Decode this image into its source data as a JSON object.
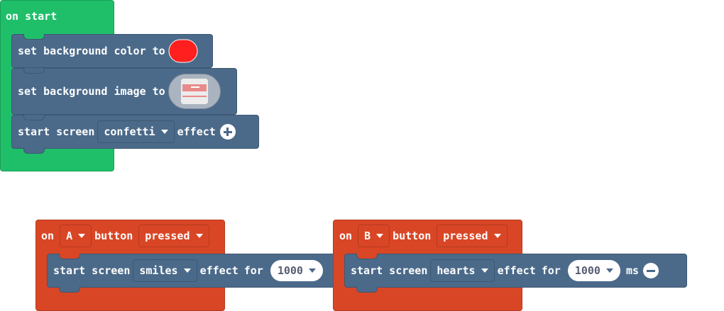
{
  "workspace": {
    "on_start": {
      "label": "on start",
      "set_bg_color": {
        "label": "set background color to",
        "color": "#ff1f1f"
      },
      "set_bg_image": {
        "label": "set background image to"
      },
      "start_screen": {
        "label": "start screen",
        "effect_value": "confetti",
        "effect_label": "effect"
      }
    },
    "on_a": {
      "on_label": "on",
      "button_value": "A",
      "button_label": "button",
      "event_value": "pressed",
      "start_screen": {
        "label": "start screen",
        "effect_value": "smiles",
        "effect_label": "effect",
        "for_label": "for",
        "duration": "1000"
      }
    },
    "on_b": {
      "on_label": "on",
      "button_value": "B",
      "button_label": "button",
      "event_value": "pressed",
      "start_screen": {
        "label": "start screen",
        "effect_value": "hearts",
        "effect_label": "effect",
        "for_label": "for",
        "duration": "1000",
        "unit_label": "ms"
      }
    }
  },
  "icons": {
    "expand": "plus-circle-icon",
    "collapse": "minus-circle-icon",
    "dropdown": "caret-down-icon"
  },
  "colors": {
    "event_green": "#1fbf6a",
    "event_orange": "#d94626",
    "statement_blue": "#4b6a8a"
  }
}
